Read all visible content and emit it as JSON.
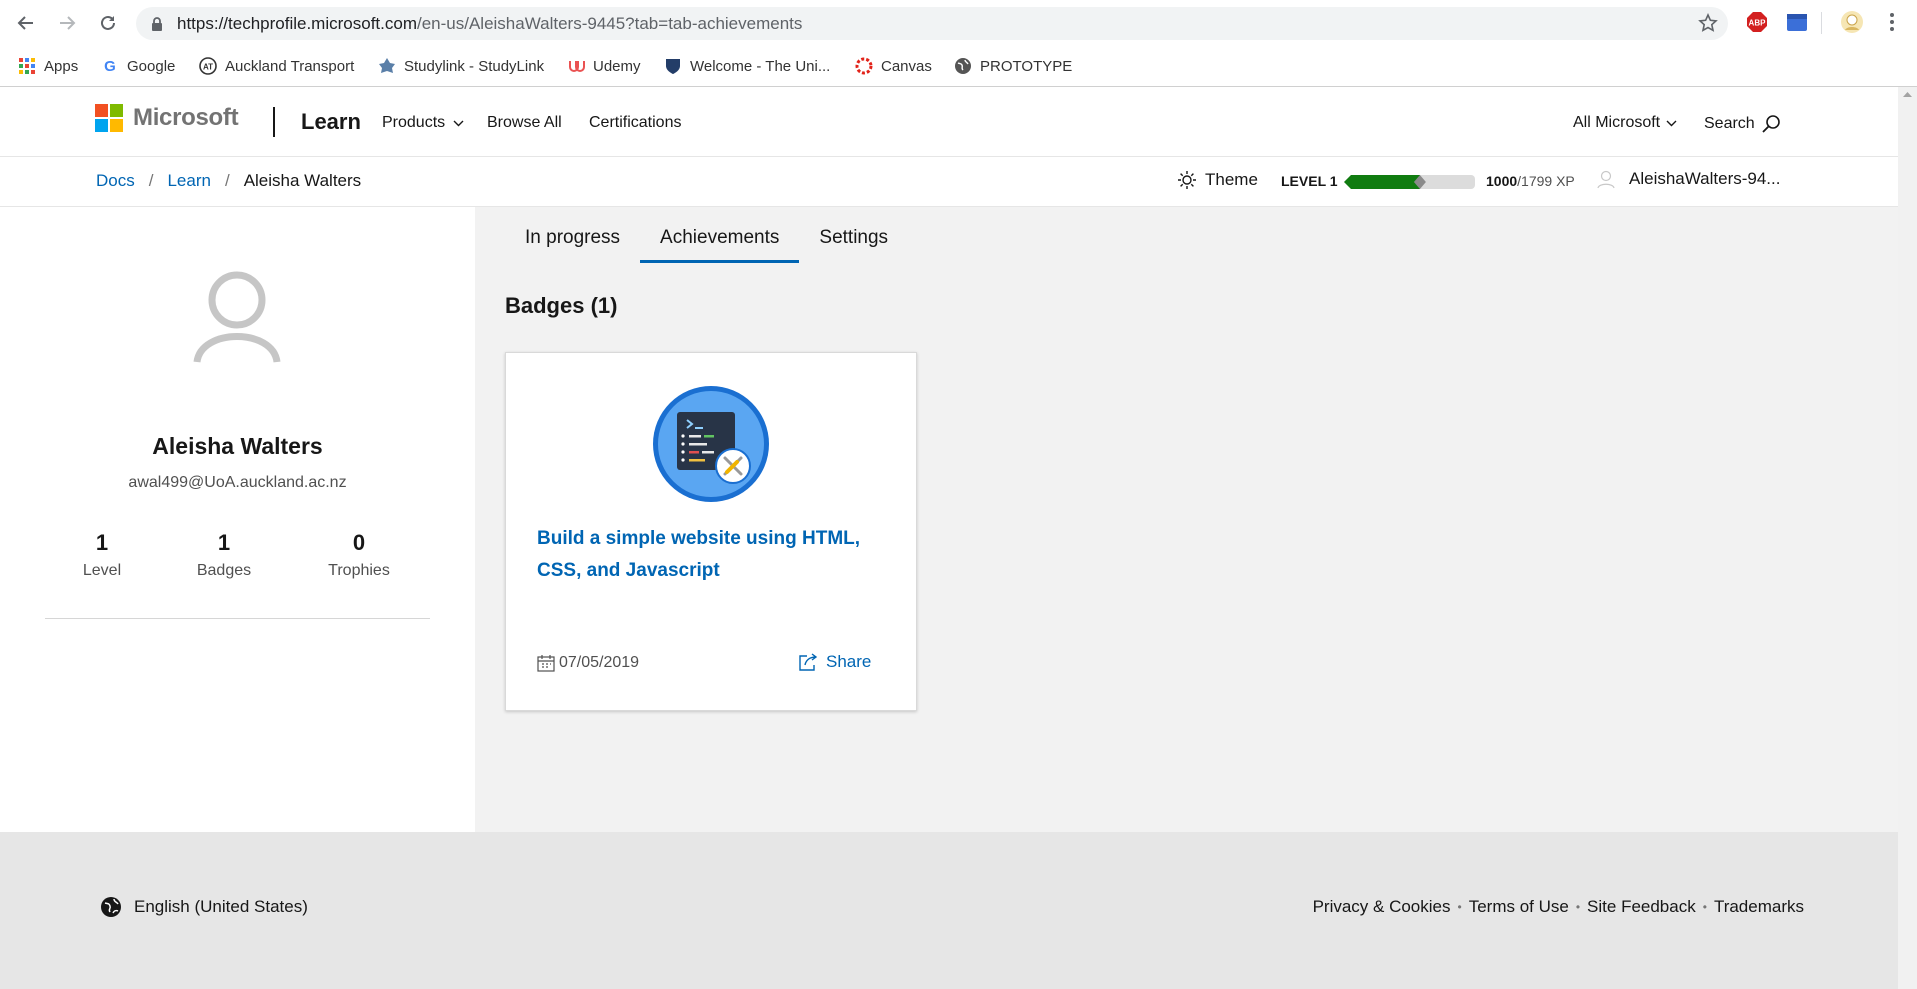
{
  "browser": {
    "url_host": "https://techprofile.microsoft.com",
    "url_path": "/en-us/AleishaWalters-9445?tab=tab-achievements",
    "extensions": [
      "ABP"
    ]
  },
  "bookmarks": [
    {
      "label": "Apps",
      "icon": "apps-grid-icon"
    },
    {
      "label": "Google",
      "icon": "google-icon"
    },
    {
      "label": "Auckland Transport",
      "icon": "auckland-transport-icon"
    },
    {
      "label": "Studylink - StudyLink",
      "icon": "studylink-icon"
    },
    {
      "label": "Udemy",
      "icon": "udemy-icon"
    },
    {
      "label": "Welcome - The Uni...",
      "icon": "university-shield-icon"
    },
    {
      "label": "Canvas",
      "icon": "canvas-icon"
    },
    {
      "label": "PROTOTYPE",
      "icon": "globe-icon"
    }
  ],
  "header": {
    "brand": "Microsoft",
    "product": "Learn",
    "nav": [
      "Products",
      "Browse All",
      "Certifications"
    ],
    "all_microsoft": "All Microsoft",
    "search": "Search"
  },
  "subbar": {
    "breadcrumbs": [
      "Docs",
      "Learn",
      "Aleisha Walters"
    ],
    "theme": "Theme",
    "level_label": "LEVEL 1",
    "xp_current": "1000",
    "xp_total": "/1799 XP",
    "xp_progress": 0.5558,
    "username": "AleishaWalters-94..."
  },
  "profile": {
    "name": "Aleisha Walters",
    "email": "awal499@UoA.auckland.ac.nz",
    "stats": [
      {
        "value": "1",
        "label": "Level"
      },
      {
        "value": "1",
        "label": "Badges"
      },
      {
        "value": "0",
        "label": "Trophies"
      }
    ]
  },
  "tabs": [
    "In progress",
    "Achievements",
    "Settings"
  ],
  "active_tab": "Achievements",
  "badges_section": {
    "title": "Badges (1)",
    "items": [
      {
        "title": "Build a simple website using HTML, CSS, and Javascript",
        "date": "07/05/2019",
        "share": "Share"
      }
    ]
  },
  "footer": {
    "locale": "English (United States)",
    "links": [
      "Privacy & Cookies",
      "Terms of Use",
      "Site Feedback",
      "Trademarks"
    ]
  },
  "colors": {
    "link_blue": "#0065b3",
    "xp_green": "#107c10",
    "ms_red": "#f25022",
    "ms_green": "#7fba00",
    "ms_blue": "#00a4ef",
    "ms_yellow": "#ffb900"
  }
}
